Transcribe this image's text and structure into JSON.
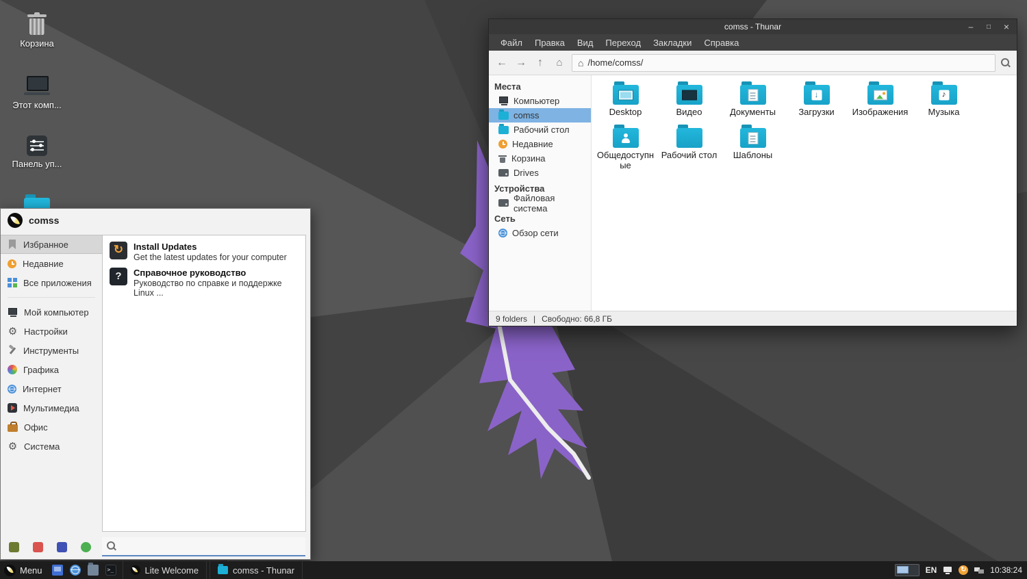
{
  "colors": {
    "wallpaper_base": "#4a4a4a",
    "accent_purple": "#8a63c8",
    "folder_cyan": "#1db0d6",
    "selection_blue": "#7eb3e3",
    "taskbar_bg": "#1d1d1d"
  },
  "desktop": {
    "icons": [
      {
        "label": "Корзина",
        "icon": "trash-icon"
      },
      {
        "label": "Этот комп...",
        "icon": "computer-icon"
      },
      {
        "label": "Панель уп...",
        "icon": "control-panel-icon"
      },
      {
        "label": "",
        "icon": "folder-icon"
      }
    ]
  },
  "thunar": {
    "title": "comss - Thunar",
    "menubar": [
      "Файл",
      "Правка",
      "Вид",
      "Переход",
      "Закладки",
      "Справка"
    ],
    "path": "/home/comss/",
    "sidebar": {
      "places_header": "Места",
      "places": [
        {
          "label": "Компьютер",
          "icon": "computer-icon"
        },
        {
          "label": "comss",
          "icon": "folder-icon"
        },
        {
          "label": "Рабочий стол",
          "icon": "folder-icon"
        },
        {
          "label": "Недавние",
          "icon": "clock-icon"
        },
        {
          "label": "Корзина",
          "icon": "trash-icon"
        },
        {
          "label": "Drives",
          "icon": "drive-icon"
        }
      ],
      "devices_header": "Устройства",
      "devices": [
        {
          "label": "Файловая система",
          "icon": "drive-icon"
        }
      ],
      "network_header": "Сеть",
      "network": [
        {
          "label": "Обзор сети",
          "icon": "network-icon"
        }
      ]
    },
    "files": [
      {
        "label": "Desktop",
        "icon": "folder-desktop-icon"
      },
      {
        "label": "Видео",
        "icon": "folder-video-icon"
      },
      {
        "label": "Документы",
        "icon": "folder-documents-icon"
      },
      {
        "label": "Загрузки",
        "icon": "folder-downloads-icon"
      },
      {
        "label": "Изображения",
        "icon": "folder-pictures-icon"
      },
      {
        "label": "Музыка",
        "icon": "folder-music-icon"
      },
      {
        "label": "Общедоступные",
        "icon": "folder-public-icon"
      },
      {
        "label": "Рабочий стол",
        "icon": "folder-icon"
      },
      {
        "label": "Шаблоны",
        "icon": "folder-templates-icon"
      }
    ],
    "statusbar": {
      "folders": "9 folders",
      "divider": "|",
      "free_space": "Свободно: 66,8 ГБ"
    }
  },
  "menu": {
    "user": "comss",
    "categories": [
      {
        "label": "Избранное",
        "icon": "bookmark-icon"
      },
      {
        "label": "Недавние",
        "icon": "clock-icon"
      },
      {
        "label": "Все приложения",
        "icon": "apps-grid-icon"
      },
      {
        "label": "Мой компьютер",
        "icon": "computer-icon"
      },
      {
        "label": "Настройки",
        "icon": "settings-icon"
      },
      {
        "label": "Инструменты",
        "icon": "tools-icon"
      },
      {
        "label": "Графика",
        "icon": "graphics-icon"
      },
      {
        "label": "Интернет",
        "icon": "globe-icon"
      },
      {
        "label": "Мультимедиа",
        "icon": "multimedia-icon"
      },
      {
        "label": "Офис",
        "icon": "office-icon"
      },
      {
        "label": "Система",
        "icon": "system-icon"
      }
    ],
    "results": [
      {
        "title": "Install Updates",
        "subtitle": "Get the latest updates for your computer",
        "icon": "updates-icon"
      },
      {
        "title": "Справочное руководство",
        "subtitle": "Руководство по справке и поддержке Linux ...",
        "icon": "help-icon"
      }
    ],
    "search": {
      "value": "",
      "placeholder": ""
    }
  },
  "taskbar": {
    "menu_label": "Menu",
    "tasks": [
      {
        "label": "Lite Welcome",
        "icon": "welcome-icon"
      },
      {
        "label": "comss - Thunar",
        "icon": "folder-icon"
      }
    ],
    "tray": {
      "lang": "EN",
      "clock": "10:38:24"
    }
  }
}
